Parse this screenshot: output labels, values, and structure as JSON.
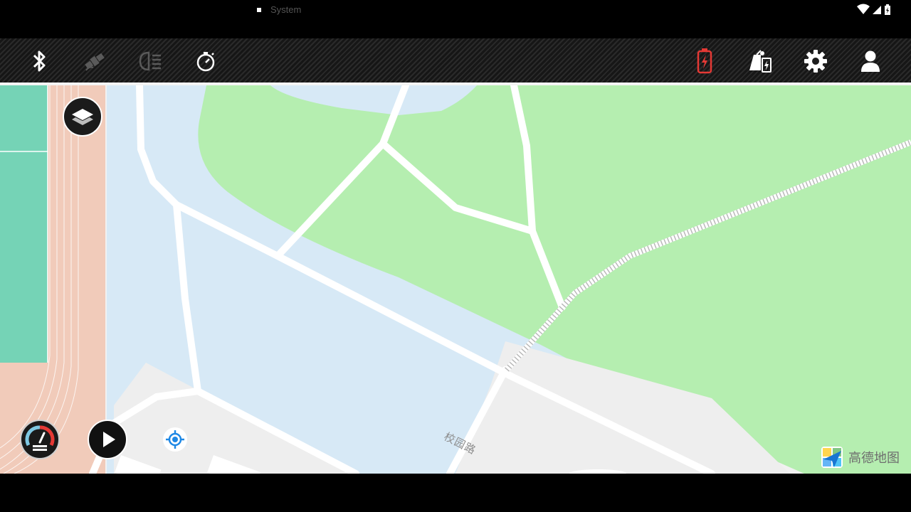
{
  "status_bar": {
    "notification_label": "System",
    "icons": [
      "wifi-icon",
      "signal-icon",
      "battery-charging-icon"
    ]
  },
  "toolbar": {
    "left_icons": [
      "bluetooth-icon",
      "satellite-icon",
      "headlight-icon",
      "timer-icon"
    ],
    "right_icons": [
      "battery-charging-icon",
      "remote-controller-battery-icon",
      "settings-gear-icon",
      "user-profile-icon"
    ],
    "colors": {
      "battery_alert": "#e53935",
      "active_icon": "#ffffff",
      "inactive_icon": "#5a5a5a"
    }
  },
  "map": {
    "road_label": "校园路",
    "provider_logo_text": "高德地图",
    "colors": {
      "park": "#b5eeb0",
      "water": "#d7e9f6",
      "track": "#f1cbba",
      "field": "#75d3b6",
      "road": "#ffffff",
      "ground": "#f1f1f1",
      "flight_path": "#ffffff"
    },
    "buttons": [
      "layers-button",
      "speed-gauge-button",
      "play-button",
      "locate-button"
    ]
  }
}
